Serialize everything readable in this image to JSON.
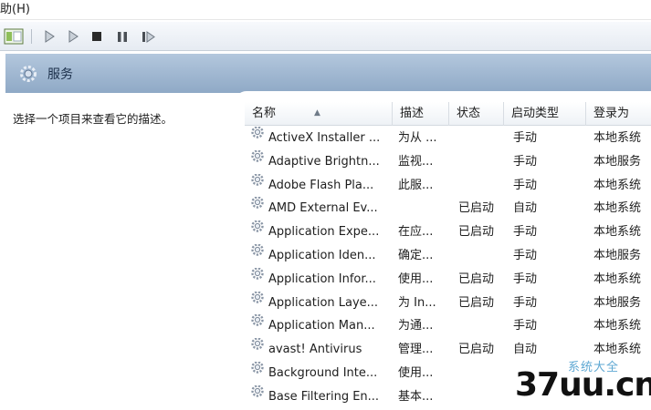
{
  "menu": {
    "help": "助(H)"
  },
  "toolbar": {
    "icons": [
      "view-pane-icon",
      "play-icon",
      "play-icon",
      "stop-icon",
      "pause-icon",
      "restart-icon"
    ]
  },
  "header": {
    "title": "服务"
  },
  "description_text": "选择一个项目来查看它的描述。",
  "columns": [
    "名称",
    "描述",
    "状态",
    "启动类型",
    "登录为"
  ],
  "rows": [
    {
      "name": "ActiveX Installer ...",
      "description": "为从 ...",
      "status": "",
      "startup": "手动",
      "logon": "本地系统"
    },
    {
      "name": "Adaptive Brightn...",
      "description": "监视...",
      "status": "",
      "startup": "手动",
      "logon": "本地服务"
    },
    {
      "name": "Adobe Flash Pla...",
      "description": "此服...",
      "status": "",
      "startup": "手动",
      "logon": "本地系统"
    },
    {
      "name": "AMD External Ev...",
      "description": "",
      "status": "已启动",
      "startup": "自动",
      "logon": "本地系统"
    },
    {
      "name": "Application Expe...",
      "description": "在应...",
      "status": "已启动",
      "startup": "手动",
      "logon": "本地系统"
    },
    {
      "name": "Application Iden...",
      "description": "确定...",
      "status": "",
      "startup": "手动",
      "logon": "本地服务"
    },
    {
      "name": "Application Infor...",
      "description": "使用...",
      "status": "已启动",
      "startup": "手动",
      "logon": "本地系统"
    },
    {
      "name": "Application Laye...",
      "description": "为 In...",
      "status": "已启动",
      "startup": "手动",
      "logon": "本地服务"
    },
    {
      "name": "Application Man...",
      "description": "为通...",
      "status": "",
      "startup": "手动",
      "logon": "本地系统"
    },
    {
      "name": "avast! Antivirus",
      "description": "管理...",
      "status": "已启动",
      "startup": "自动",
      "logon": "本地系统"
    },
    {
      "name": "Background Inte...",
      "description": "使用...",
      "status": "",
      "startup": "",
      "logon": ""
    },
    {
      "name": "Base Filtering En...",
      "description": "基本...",
      "status": "",
      "startup": "",
      "logon": ""
    }
  ],
  "watermark": {
    "main": "37uu.cn",
    "sub": "系统大全"
  }
}
